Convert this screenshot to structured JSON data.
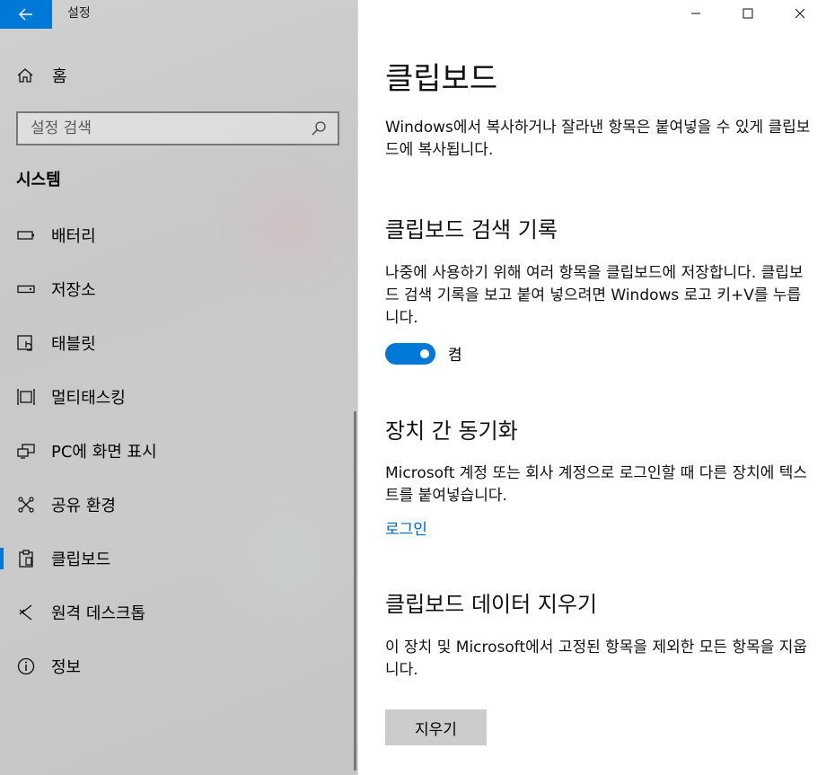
{
  "window": {
    "title": "설정"
  },
  "sidebar": {
    "home_label": "홈",
    "search_placeholder": "설정 검색",
    "section_title": "시스템",
    "items": [
      {
        "label": "배터리",
        "icon": "battery-icon"
      },
      {
        "label": "저장소",
        "icon": "storage-icon"
      },
      {
        "label": "태블릿",
        "icon": "tablet-icon"
      },
      {
        "label": "멀티태스킹",
        "icon": "multitasking-icon"
      },
      {
        "label": "PC에 화면 표시",
        "icon": "project-to-pc-icon"
      },
      {
        "label": "공유 환경",
        "icon": "shared-experiences-icon"
      },
      {
        "label": "클립보드",
        "icon": "clipboard-icon",
        "active": true
      },
      {
        "label": "원격 데스크톱",
        "icon": "remote-desktop-icon"
      },
      {
        "label": "정보",
        "icon": "info-icon"
      }
    ]
  },
  "main": {
    "title": "클립보드",
    "intro": "Windows에서 복사하거나 잘라낸 항목은 붙여넣을 수 있게 클립보드에 복사됩니다.",
    "history": {
      "heading": "클립보드 검색 기록",
      "description": "나중에 사용하기 위해 여러 항목을 클립보드에 저장합니다. 클립보드 검색 기록을 보고 붙여 넣으려면 Windows 로고 키+V를 누릅니다.",
      "toggle_state": "켬",
      "toggle_on": true
    },
    "sync": {
      "heading": "장치 간 동기화",
      "description": "Microsoft 계정 또는 회사 계정으로 로그인할 때 다른 장치에 텍스트를 붙여넣습니다.",
      "link": "로그인"
    },
    "clear": {
      "heading": "클립보드 데이터 지우기",
      "description": "이 장치 및 Microsoft에서 고정된 항목을 제외한 모든 항목을 지웁니다.",
      "button": "지우기"
    }
  },
  "colors": {
    "accent": "#0078d7",
    "link": "#0067b8"
  }
}
